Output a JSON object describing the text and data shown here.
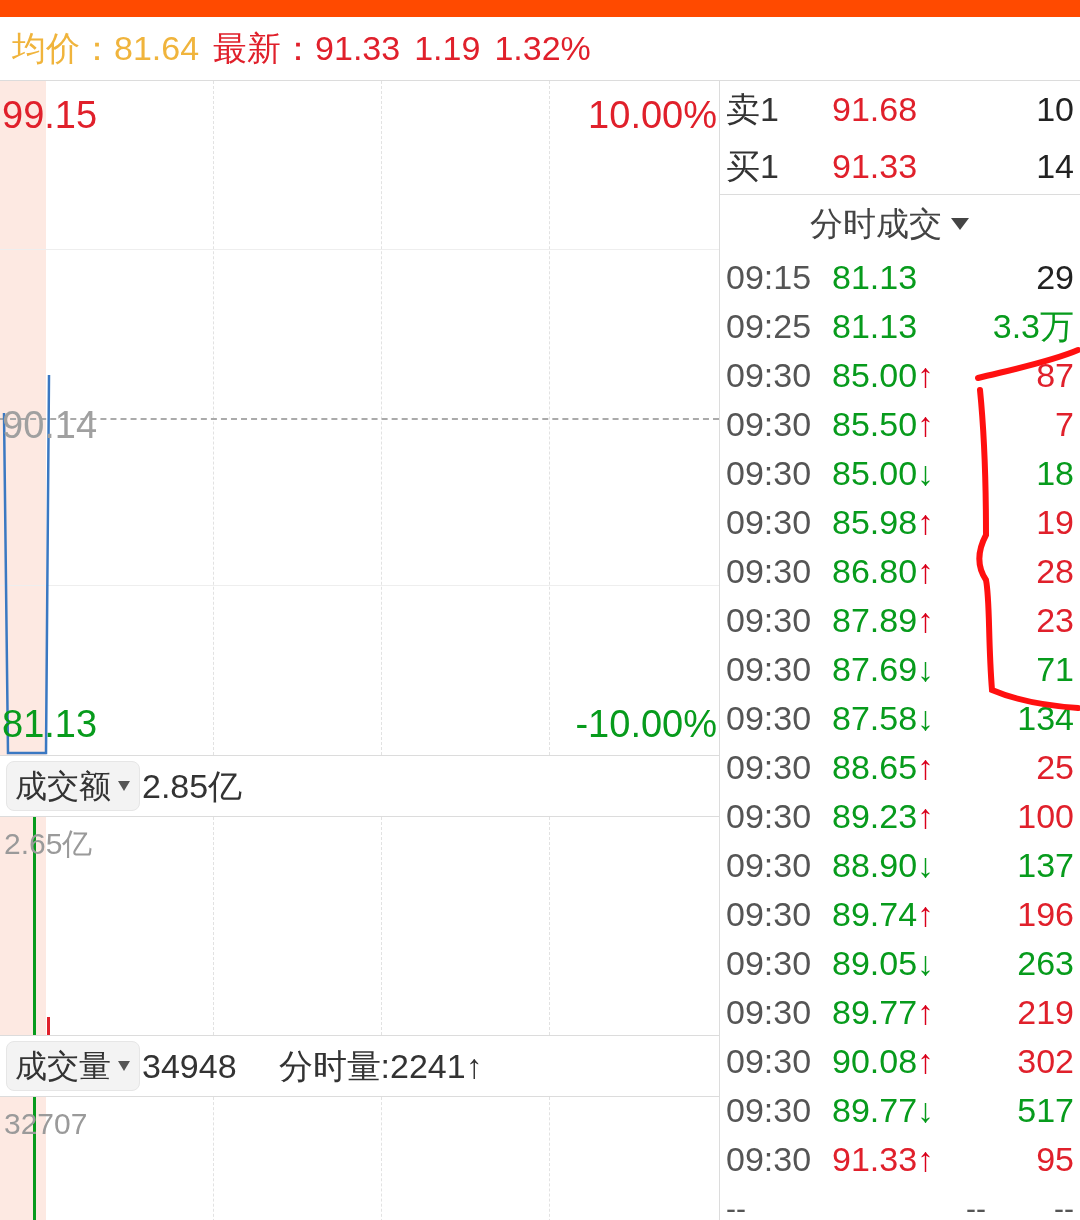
{
  "header": {
    "avg_label": "均价：",
    "avg_value": "81.64",
    "last_label": "最新：",
    "last_value": "91.33",
    "change": "1.19",
    "change_pct": "1.32%"
  },
  "price_chart": {
    "high": "99.15",
    "high_pct": "10.00%",
    "mid": "90.14",
    "low": "81.13",
    "low_pct": "-10.00%"
  },
  "amount_panel": {
    "selector": "成交额",
    "value": "2.85亿",
    "axis_max": "2.65亿"
  },
  "volume_panel": {
    "selector": "成交量",
    "value": "34948",
    "tick_volume": "分时量:2241↑",
    "axis_max": "32707"
  },
  "order_book": [
    {
      "side": "卖1",
      "price": "91.68",
      "volume": "10"
    },
    {
      "side": "买1",
      "price": "91.33",
      "volume": "14"
    }
  ],
  "ticks_header": "分时成交",
  "ticks": [
    {
      "time": "09:15",
      "price": {
        "text": "81.13",
        "color": "#079b1c"
      },
      "volume": {
        "text": "29",
        "color": "#222222"
      }
    },
    {
      "time": "09:25",
      "price": {
        "text": "81.13",
        "color": "#079b1c"
      },
      "volume": {
        "text": "3.3万",
        "color": "#079b1c"
      }
    },
    {
      "time": "09:30",
      "price": {
        "text": "85.00",
        "color": "#079b1c"
      },
      "arrow": {
        "text": "↑",
        "color": "#d9001b"
      },
      "volume": {
        "text": "87",
        "color": "#e0202b"
      }
    },
    {
      "time": "09:30",
      "price": {
        "text": "85.50",
        "color": "#079b1c"
      },
      "arrow": {
        "text": "↑",
        "color": "#d9001b"
      },
      "volume": {
        "text": "7",
        "color": "#e0202b"
      }
    },
    {
      "time": "09:30",
      "price": {
        "text": "85.00",
        "color": "#079b1c"
      },
      "arrow": {
        "text": "↓",
        "color": "#079b1c"
      },
      "volume": {
        "text": "18",
        "color": "#079b1c"
      }
    },
    {
      "time": "09:30",
      "price": {
        "text": "85.98",
        "color": "#079b1c"
      },
      "arrow": {
        "text": "↑",
        "color": "#d9001b"
      },
      "volume": {
        "text": "19",
        "color": "#e0202b"
      }
    },
    {
      "time": "09:30",
      "price": {
        "text": "86.80",
        "color": "#079b1c"
      },
      "arrow": {
        "text": "↑",
        "color": "#d9001b"
      },
      "volume": {
        "text": "28",
        "color": "#e0202b"
      }
    },
    {
      "time": "09:30",
      "price": {
        "text": "87.89",
        "color": "#079b1c"
      },
      "arrow": {
        "text": "↑",
        "color": "#d9001b"
      },
      "volume": {
        "text": "23",
        "color": "#e0202b"
      }
    },
    {
      "time": "09:30",
      "price": {
        "text": "87.69",
        "color": "#079b1c"
      },
      "arrow": {
        "text": "↓",
        "color": "#079b1c"
      },
      "volume": {
        "text": "71",
        "color": "#079b1c"
      }
    },
    {
      "time": "09:30",
      "price": {
        "text": "87.58",
        "color": "#079b1c"
      },
      "arrow": {
        "text": "↓",
        "color": "#079b1c"
      },
      "volume": {
        "text": "134",
        "color": "#079b1c"
      }
    },
    {
      "time": "09:30",
      "price": {
        "text": "88.65",
        "color": "#079b1c"
      },
      "arrow": {
        "text": "↑",
        "color": "#d9001b"
      },
      "volume": {
        "text": "25",
        "color": "#e0202b"
      }
    },
    {
      "time": "09:30",
      "price": {
        "text": "89.23",
        "color": "#079b1c"
      },
      "arrow": {
        "text": "↑",
        "color": "#d9001b"
      },
      "volume": {
        "text": "100",
        "color": "#e0202b"
      }
    },
    {
      "time": "09:30",
      "price": {
        "text": "88.90",
        "color": "#079b1c"
      },
      "arrow": {
        "text": "↓",
        "color": "#079b1c"
      },
      "volume": {
        "text": "137",
        "color": "#079b1c"
      }
    },
    {
      "time": "09:30",
      "price": {
        "text": "89.74",
        "color": "#079b1c"
      },
      "arrow": {
        "text": "↑",
        "color": "#d9001b"
      },
      "volume": {
        "text": "196",
        "color": "#e0202b"
      }
    },
    {
      "time": "09:30",
      "price": {
        "text": "89.05",
        "color": "#079b1c"
      },
      "arrow": {
        "text": "↓",
        "color": "#079b1c"
      },
      "volume": {
        "text": "263",
        "color": "#079b1c"
      }
    },
    {
      "time": "09:30",
      "price": {
        "text": "89.77",
        "color": "#079b1c"
      },
      "arrow": {
        "text": "↑",
        "color": "#d9001b"
      },
      "volume": {
        "text": "219",
        "color": "#e0202b"
      }
    },
    {
      "time": "09:30",
      "price": {
        "text": "90.08",
        "color": "#079b1c"
      },
      "arrow": {
        "text": "↑",
        "color": "#d9001b"
      },
      "volume": {
        "text": "302",
        "color": "#e0202b"
      }
    },
    {
      "time": "09:30",
      "price": {
        "text": "89.77",
        "color": "#079b1c"
      },
      "arrow": {
        "text": "↓",
        "color": "#079b1c"
      },
      "volume": {
        "text": "517",
        "color": "#079b1c"
      }
    },
    {
      "time": "09:30",
      "price": {
        "text": "91.33",
        "color": "#e0202b"
      },
      "arrow": {
        "text": "↑",
        "color": "#d9001b"
      },
      "volume": {
        "text": "95",
        "color": "#e0202b"
      }
    }
  ],
  "ticks_footer": [
    "--",
    "--",
    "--"
  ]
}
